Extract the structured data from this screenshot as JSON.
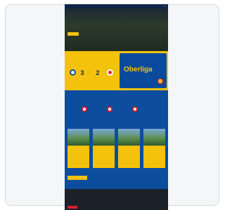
{
  "header": {
    "title": "",
    "close_label": "×"
  },
  "hero": {
    "small": "",
    "title": "",
    "subtitle": "",
    "button_label": ""
  },
  "match": {
    "label": "",
    "name": "",
    "round": "",
    "home_score": "3",
    "away_score": "2",
    "separator": ":"
  },
  "promo": {
    "title": "Oberliga"
  },
  "fixtures": {
    "title": "",
    "items": [
      {
        "text": ""
      },
      {
        "text": ""
      },
      {
        "text": ""
      }
    ]
  },
  "news": {
    "title": "",
    "more_label": "",
    "cards": [
      {
        "text": "",
        "date": ""
      },
      {
        "text": "",
        "date": ""
      },
      {
        "text": "",
        "date": ""
      },
      {
        "text": "",
        "date": ""
      }
    ]
  },
  "footer": {
    "title": "",
    "line": "",
    "sponsor2": "",
    "sponsor3": ""
  },
  "colors": {
    "navy": "#0f2648",
    "yellow": "#f4c20d",
    "blue": "#0a4a9c",
    "red": "#d8202c",
    "frame": "#d4d9e0"
  }
}
